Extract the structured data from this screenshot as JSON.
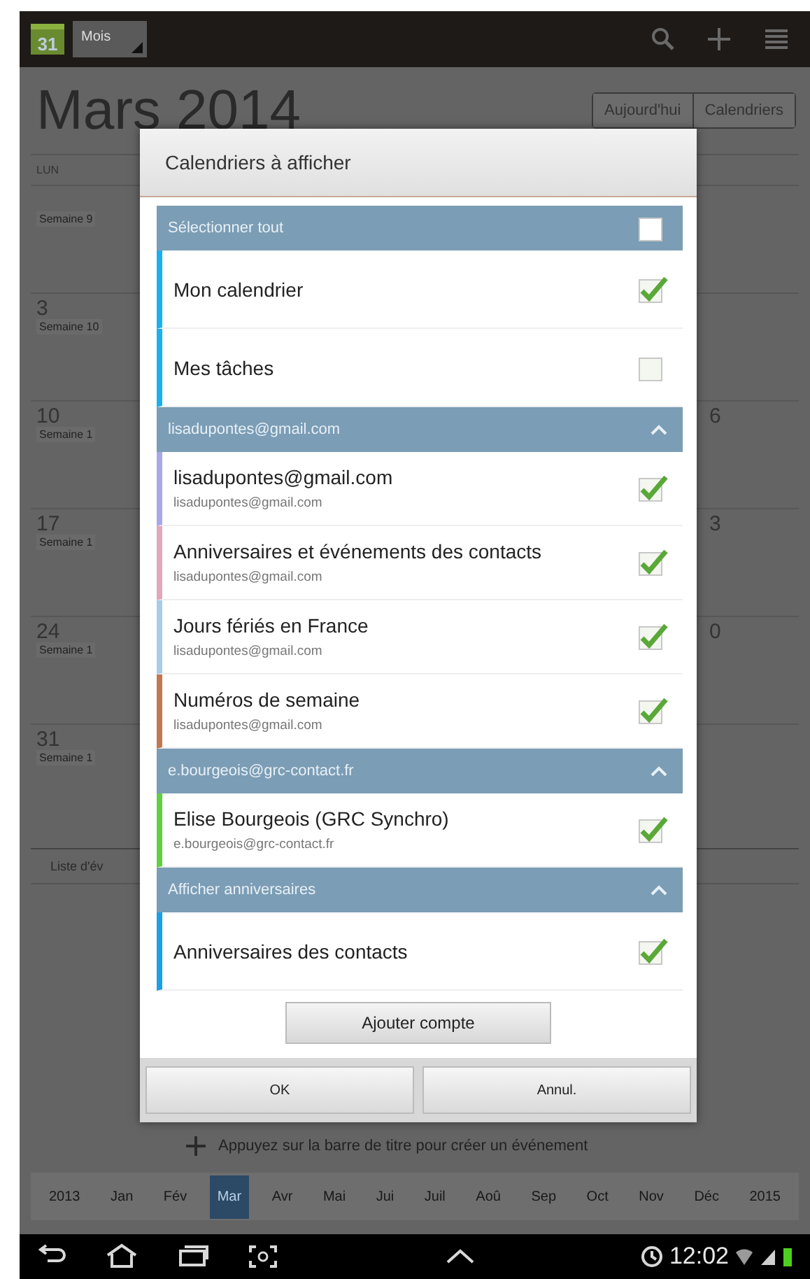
{
  "app_bar": {
    "date_badge": "31",
    "view_selector": "Mois"
  },
  "calendar": {
    "title": "Mars 2014",
    "buttons": [
      "Aujourd'hui",
      "Calendriers"
    ],
    "day_header": "LUN",
    "weeks": [
      {
        "label": "Semaine 9"
      },
      {
        "date": "3",
        "label": "Semaine 10"
      },
      {
        "date": "10",
        "label": "Semaine 1",
        "end_date": "6"
      },
      {
        "date": "17",
        "label": "Semaine 1",
        "end_date": "3"
      },
      {
        "date": "24",
        "label": "Semaine 1",
        "end_date": "0"
      },
      {
        "date": "31",
        "label": "Semaine 1"
      }
    ],
    "list_tab": "Liste d'év",
    "hint": "Appuyez sur la barre de titre pour créer un événement",
    "months": [
      {
        "label": "2013",
        "selected": false
      },
      {
        "label": "Jan",
        "selected": false
      },
      {
        "label": "Fév",
        "selected": false
      },
      {
        "label": "Mar",
        "selected": true
      },
      {
        "label": "Avr",
        "selected": false
      },
      {
        "label": "Mai",
        "selected": false
      },
      {
        "label": "Jui",
        "selected": false
      },
      {
        "label": "Juil",
        "selected": false
      },
      {
        "label": "Aoû",
        "selected": false
      },
      {
        "label": "Sep",
        "selected": false
      },
      {
        "label": "Oct",
        "selected": false
      },
      {
        "label": "Nov",
        "selected": false
      },
      {
        "label": "Déc",
        "selected": false
      },
      {
        "label": "2015",
        "selected": false
      }
    ]
  },
  "dialog": {
    "title": "Calendriers à afficher",
    "sections": [
      {
        "kind": "select-all",
        "header": "Sélectionner tout",
        "checked": false,
        "items": [
          {
            "name": "Mon calendrier",
            "checked": true,
            "color": "#1ab0f0"
          },
          {
            "name": "Mes tâches",
            "checked": false,
            "color": "#1ab0f0"
          }
        ]
      },
      {
        "kind": "account",
        "header": "lisadupontes@gmail.com",
        "expanded": true,
        "items": [
          {
            "name": "lisadupontes@gmail.com",
            "account": "lisadupontes@gmail.com",
            "checked": true,
            "color": "#a8a8e8"
          },
          {
            "name": "Anniversaires et événements des contacts",
            "account": "lisadupontes@gmail.com",
            "checked": true,
            "color": "#e0a8b8"
          },
          {
            "name": "Jours fériés en France",
            "account": "lisadupontes@gmail.com",
            "checked": true,
            "color": "#a8cce8"
          },
          {
            "name": "Numéros de semaine",
            "account": "lisadupontes@gmail.com",
            "checked": true,
            "color": "#c07850"
          }
        ]
      },
      {
        "kind": "account",
        "header": "e.bourgeois@grc-contact.fr",
        "expanded": true,
        "items": [
          {
            "name": "Elise Bourgeois (GRC Synchro)",
            "account": "e.bourgeois@grc-contact.fr",
            "checked": true,
            "color": "#60d040"
          }
        ]
      },
      {
        "kind": "account",
        "header": "Afficher anniversaires",
        "expanded": true,
        "items": [
          {
            "name": "Anniversaires des contacts",
            "checked": true,
            "color": "#1aa0e8"
          }
        ]
      }
    ],
    "add_button": "Ajouter compte",
    "buttons": [
      "OK",
      "Annul."
    ]
  },
  "status_bar": {
    "time": "12:02"
  }
}
